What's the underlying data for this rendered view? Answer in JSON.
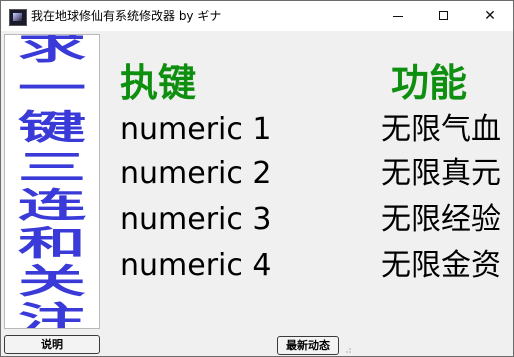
{
  "window": {
    "title": "我在地球修仙有系统修改器 by ギナ",
    "minimize_glyph": "",
    "maximize_glyph": "",
    "close_glyph": "✕"
  },
  "banner": {
    "chars": [
      "求",
      "一",
      "键",
      "三",
      "连",
      "和",
      "关",
      "注"
    ],
    "color": "#3a3ad8"
  },
  "table": {
    "header_key": "执键",
    "header_function": "功能",
    "header_color": "#0f8f0f",
    "rows": [
      {
        "key": "numeric 1",
        "function": "无限气血"
      },
      {
        "key": "numeric 2",
        "function": "无限真元"
      },
      {
        "key": "numeric 3",
        "function": "无限经验"
      },
      {
        "key": "numeric 4",
        "function": "无限金资"
      }
    ]
  },
  "buttons": {
    "help_label": "说明",
    "news_label": "最新动态"
  }
}
